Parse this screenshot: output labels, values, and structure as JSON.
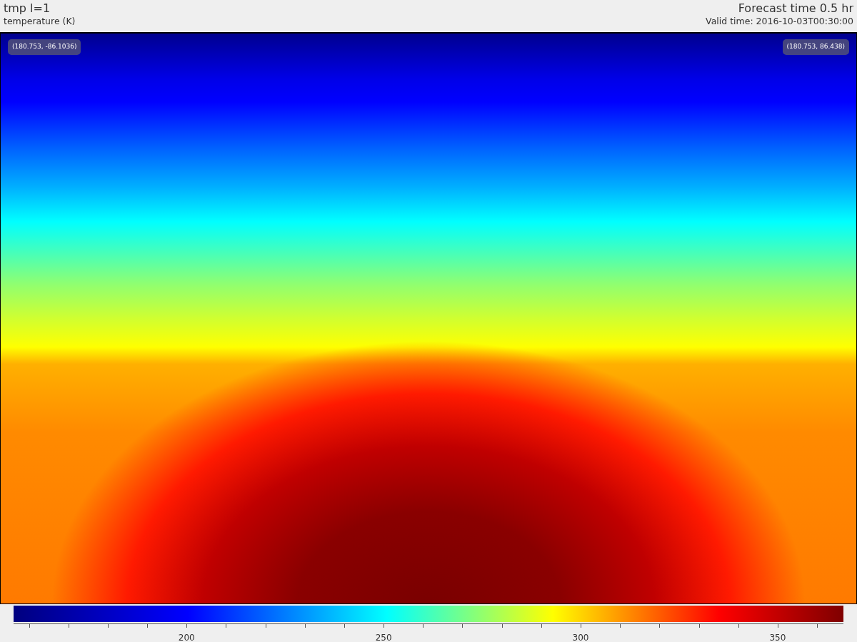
{
  "header": {
    "title": "tmp l=1",
    "subtitle": "temperature (K)",
    "forecast": "Forecast time 0.5 hr",
    "valid_time": "Valid time: 2016-10-03T00:30:00"
  },
  "plot": {
    "corner_labels": [
      "(180.753, -86.1036)",
      "(180.753, 86.438)"
    ]
  },
  "colorbar": {
    "tick_labels": [
      "200",
      "250",
      "300",
      "350"
    ]
  }
}
